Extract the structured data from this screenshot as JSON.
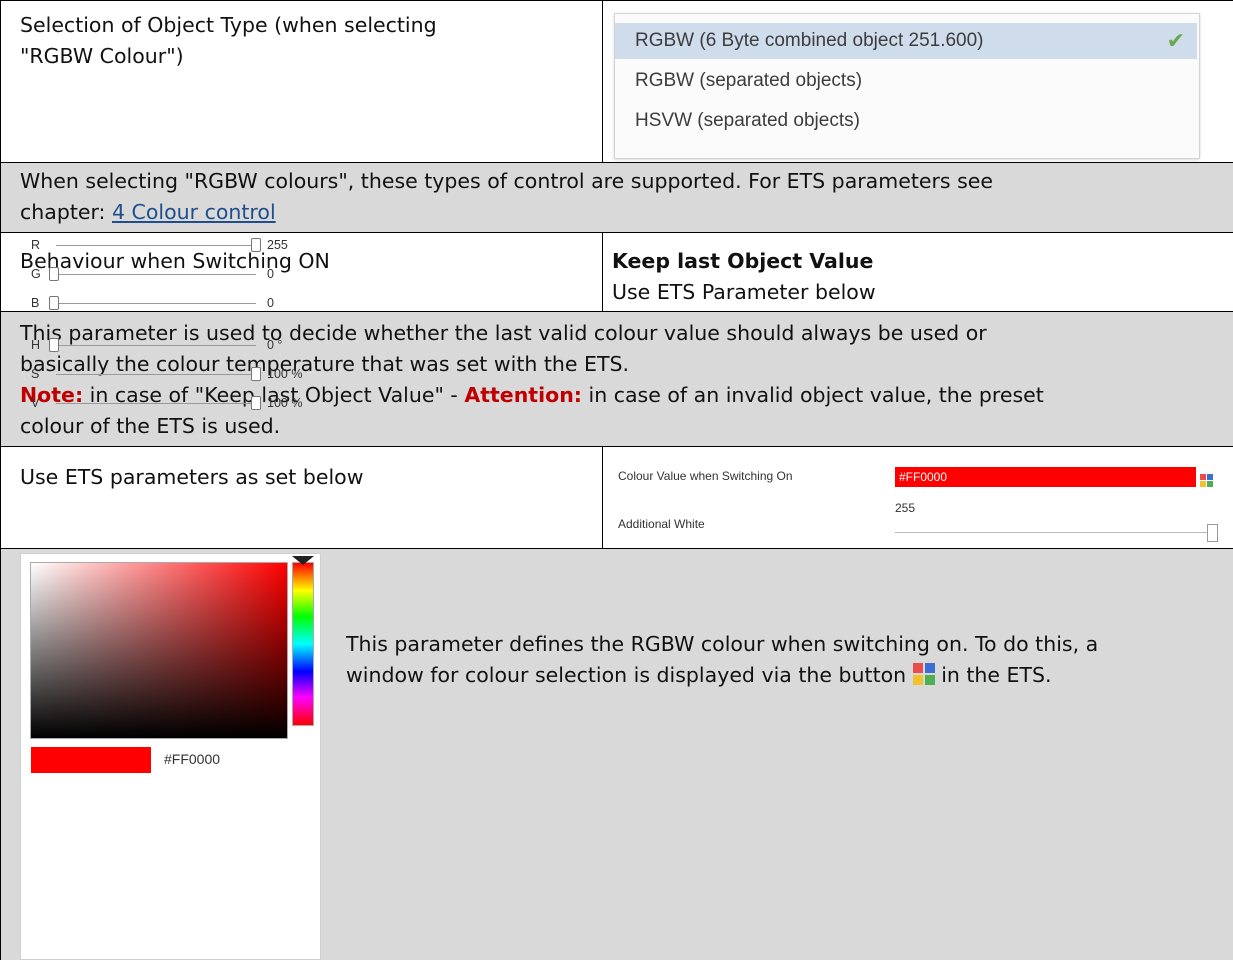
{
  "row1": {
    "label": "Selection of Object Type (when selecting \"RGBW Colour\")",
    "label_line1": "Selection of Object Type (when selecting",
    "label_line2": "\"RGBW Colour\")",
    "options": [
      "RGBW (6 Byte combined object 251.600)",
      "RGBW (separated objects)",
      "HSVW (separated objects)"
    ],
    "selected_index": 0,
    "check": "✔"
  },
  "row2": {
    "line1": "When selecting \"RGBW colours\", these types of control are supported. For ETS parameters see",
    "line2_prefix": "chapter: ",
    "link": "4 Colour control"
  },
  "row3": {
    "label": "Behaviour when Switching ON",
    "option1": "Keep last Object Value",
    "option2": "Use ETS Parameter below"
  },
  "row4": {
    "line1": "This parameter is used to decide whether the last valid colour value should always be used or",
    "line2": "basically the colour temperature that was set with the ETS.",
    "note_label": "Note:",
    "note_text": " in case of \"Keep last Object Value\" - ",
    "attention_label": "Attention:",
    "attention_text": " in case of an invalid object value, the preset",
    "line4": "colour of the ETS is used."
  },
  "row5": {
    "label": "Use ETS parameters as set below",
    "param1_label": "Colour Value when Switching On",
    "param1_value": "#FF0000",
    "param2_label": "Additional White",
    "param2_value": "255"
  },
  "row6": {
    "desc_line1": "This parameter defines the RGBW colour when switching on. To do this, a",
    "desc_line2_pre": "window for colour selection is displayed via the button ",
    "desc_line2_post": " in the ETS.",
    "picker": {
      "hex": "#FF0000",
      "sliders": [
        {
          "label": "R",
          "value": "255",
          "level": 1.0
        },
        {
          "label": "G",
          "value": "0",
          "level": 0.0
        },
        {
          "label": "B",
          "value": "0",
          "level": 0.0
        },
        {
          "label": "H",
          "value": "0 °",
          "level": 0.0
        },
        {
          "label": "S",
          "value": "100 %",
          "level": 1.0
        },
        {
          "label": "V",
          "value": "100 %",
          "level": 1.0
        }
      ]
    }
  },
  "colors": {
    "cell_gray": "#d9d9d9",
    "link": "#1f4e8c",
    "emphasis_red": "#c00000",
    "selected_bg": "#cfdcec",
    "icon_red": "#e84e4e",
    "icon_blue": "#3b6fd1",
    "icon_yellow": "#f2c12e",
    "icon_green": "#4caf50"
  }
}
